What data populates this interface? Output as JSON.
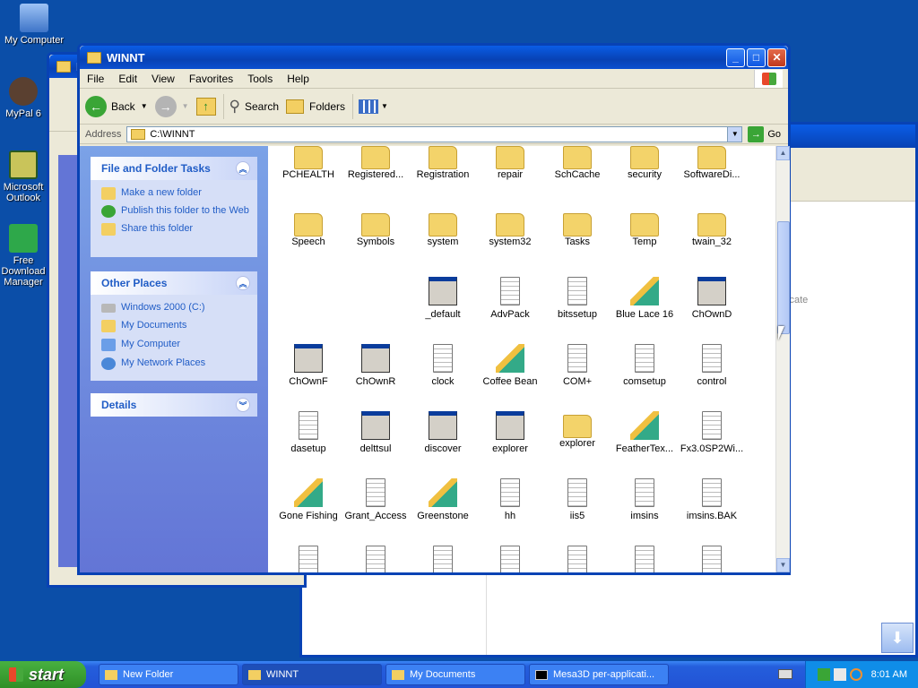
{
  "desktop": {
    "icons": [
      {
        "label": "My Computer"
      },
      {
        "label": "MyPal 6"
      },
      {
        "label": "Microsoft Outlook"
      },
      {
        "label": "Free Download Manager"
      }
    ]
  },
  "back_window": {
    "title": "N",
    "text_fragment": "ficate"
  },
  "window": {
    "title": "WINNT",
    "menu": [
      "File",
      "Edit",
      "View",
      "Favorites",
      "Tools",
      "Help"
    ],
    "toolbar": {
      "back": "Back",
      "search": "Search",
      "folders": "Folders"
    },
    "address": {
      "label": "Address",
      "value": "C:\\WINNT",
      "go": "Go"
    }
  },
  "left_pane": {
    "file_tasks": {
      "title": "File and Folder Tasks",
      "links": [
        "Make a new folder",
        "Publish this folder to the Web",
        "Share this folder"
      ]
    },
    "other_places": {
      "title": "Other Places",
      "links": [
        "Windows 2000 (C:)",
        "My Documents",
        "My Computer",
        "My Network Places"
      ]
    },
    "details": {
      "title": "Details"
    }
  },
  "files": [
    {
      "name": "PCHEALTH",
      "icon": "folder"
    },
    {
      "name": "Registered...",
      "icon": "folder"
    },
    {
      "name": "Registration",
      "icon": "folder"
    },
    {
      "name": "repair",
      "icon": "folder"
    },
    {
      "name": "SchCache",
      "icon": "folder"
    },
    {
      "name": "security",
      "icon": "folder"
    },
    {
      "name": "SoftwareDi...",
      "icon": "folder"
    },
    {
      "name": "Speech",
      "icon": "folder"
    },
    {
      "name": "Symbols",
      "icon": "folder"
    },
    {
      "name": "system",
      "icon": "folder"
    },
    {
      "name": "system32",
      "icon": "folder"
    },
    {
      "name": "Tasks",
      "icon": "folder"
    },
    {
      "name": "Temp",
      "icon": "folder"
    },
    {
      "name": "twain_32",
      "icon": "folder"
    },
    {
      "name": "",
      "icon": "none"
    },
    {
      "name": "",
      "icon": "none"
    },
    {
      "name": "_default",
      "icon": "exe"
    },
    {
      "name": "AdvPack",
      "icon": "doc"
    },
    {
      "name": "bitssetup",
      "icon": "doc"
    },
    {
      "name": "Blue Lace 16",
      "icon": "paint"
    },
    {
      "name": "ChOwnD",
      "icon": "exe"
    },
    {
      "name": "ChOwnF",
      "icon": "exe"
    },
    {
      "name": "ChOwnR",
      "icon": "exe"
    },
    {
      "name": "clock",
      "icon": "doc"
    },
    {
      "name": "Coffee Bean",
      "icon": "paint"
    },
    {
      "name": "COM+",
      "icon": "doc"
    },
    {
      "name": "comsetup",
      "icon": "doc"
    },
    {
      "name": "control",
      "icon": "doc"
    },
    {
      "name": "dasetup",
      "icon": "doc"
    },
    {
      "name": "delttsul",
      "icon": "exe"
    },
    {
      "name": "discover",
      "icon": "exe"
    },
    {
      "name": "explorer",
      "icon": "exe"
    },
    {
      "name": "explorer",
      "icon": "folder"
    },
    {
      "name": "FeatherTex...",
      "icon": "paint"
    },
    {
      "name": "Fx3.0SP2Wi...",
      "icon": "doc"
    },
    {
      "name": "Gone Fishing",
      "icon": "paint"
    },
    {
      "name": "Grant_Access",
      "icon": "doc"
    },
    {
      "name": "Greenstone",
      "icon": "paint"
    },
    {
      "name": "hh",
      "icon": "doc"
    },
    {
      "name": "iis5",
      "icon": "doc"
    },
    {
      "name": "imsins",
      "icon": "doc"
    },
    {
      "name": "imsins.BAK",
      "icon": "doc"
    },
    {
      "name": "",
      "icon": "doc"
    },
    {
      "name": "",
      "icon": "doc"
    },
    {
      "name": "",
      "icon": "doc"
    },
    {
      "name": "",
      "icon": "doc"
    },
    {
      "name": "",
      "icon": "doc"
    },
    {
      "name": "",
      "icon": "doc"
    },
    {
      "name": "",
      "icon": "doc"
    }
  ],
  "taskbar": {
    "start": "start",
    "tasks": [
      "New Folder",
      "WINNT",
      "My Documents",
      "Mesa3D per-applicati..."
    ],
    "clock": "8:01 AM"
  }
}
